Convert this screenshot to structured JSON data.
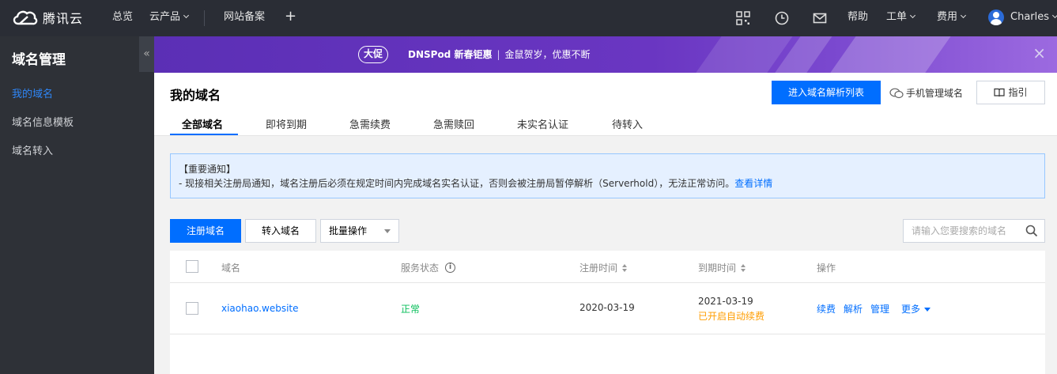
{
  "topnav": {
    "brand": "腾讯云",
    "overview": "总览",
    "products": "云产品",
    "icp": "网站备案",
    "plus": "+",
    "help": "帮助",
    "ticket": "工单",
    "billing": "费用",
    "user": "Charles"
  },
  "sidebar": {
    "title": "域名管理",
    "collapse": "«",
    "items": [
      {
        "label": "我的域名",
        "active": true
      },
      {
        "label": "域名信息模板",
        "active": false
      },
      {
        "label": "域名转入",
        "active": false
      }
    ]
  },
  "banner": {
    "badge": "大促",
    "headline": "DNSPod 新春钜惠",
    "separator": "|",
    "subline": "金鼠贺岁，优惠不断",
    "close": "×"
  },
  "header": {
    "title": "我的域名",
    "dns_button": "进入域名解析列表",
    "mobile_manage": "手机管理域名",
    "guide": "指引"
  },
  "tabs": [
    {
      "label": "全部域名",
      "active": true
    },
    {
      "label": "即将到期",
      "active": false
    },
    {
      "label": "急需续费",
      "active": false
    },
    {
      "label": "急需赎回",
      "active": false
    },
    {
      "label": "未实名认证",
      "active": false
    },
    {
      "label": "待转入",
      "active": false
    }
  ],
  "notice": {
    "title": "【重要通知】",
    "body": "- 现接相关注册局通知，域名注册后必须在规定时间内完成域名实名认证，否则会被注册局暂停解析（Serverhold），无法正常访问。",
    "link": "查看详情"
  },
  "toolbar": {
    "register": "注册域名",
    "transfer": "转入域名",
    "batch": "批量操作",
    "search_placeholder": "请输入您要搜索的域名"
  },
  "table": {
    "columns": {
      "domain": "域名",
      "status": "服务状态",
      "registered": "注册时间",
      "expires": "到期时间",
      "actions": "操作"
    },
    "rows": [
      {
        "domain": "xiaohao.website",
        "status": "正常",
        "registered": "2020-03-19",
        "expires": "2021-03-19",
        "auto_renew": "已开启自动续费",
        "actions": [
          "续费",
          "解析",
          "管理",
          "更多"
        ]
      }
    ]
  },
  "colors": {
    "primary": "#006eff",
    "nav_bg": "#2a2d35",
    "sidebar_bg": "#2e3137",
    "success": "#0abf5b",
    "warning": "#ff9d00",
    "banner": "#5b2fb5"
  }
}
